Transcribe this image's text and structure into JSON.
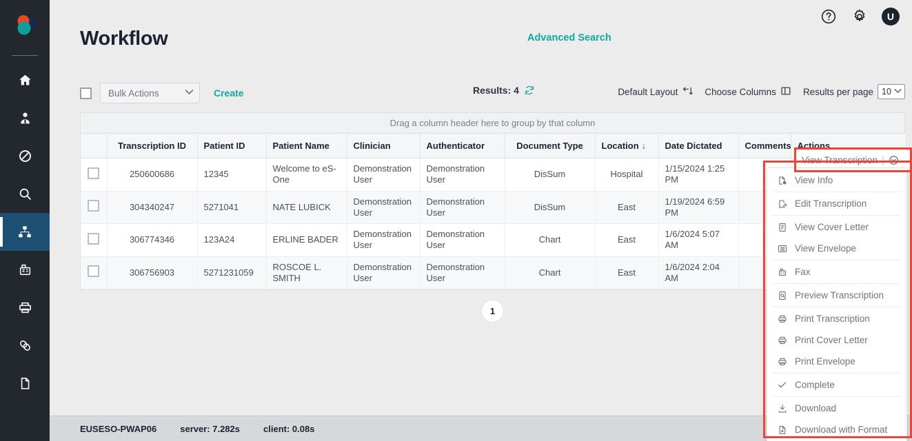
{
  "colors": {
    "sidebar_bg": "#23272e",
    "sidebar_active": "#1d4f73",
    "teal": "#10a8a0",
    "highlight_red": "#f04438",
    "text_dark": "#1b2330"
  },
  "sidebar": {
    "logo_name": "es-one-logo",
    "items": [
      {
        "name": "home-icon",
        "label": "Home",
        "active": false
      },
      {
        "name": "clinician-icon",
        "label": "Clinician",
        "active": false
      },
      {
        "name": "no-entry-icon",
        "label": "Restricted",
        "active": false
      },
      {
        "name": "search-icon",
        "label": "Search",
        "active": false
      },
      {
        "name": "workflow-icon",
        "label": "Workflow",
        "active": true
      },
      {
        "name": "fax-icon",
        "label": "Fax",
        "active": false
      },
      {
        "name": "print-icon",
        "label": "Print",
        "active": false
      },
      {
        "name": "link-icon",
        "label": "Links",
        "active": false
      },
      {
        "name": "document-icon",
        "label": "Documents",
        "active": false
      }
    ]
  },
  "header": {
    "title": "Workflow",
    "advanced_search": "Advanced Search",
    "help_icon": "help-circle-icon",
    "settings_icon": "gear-icon",
    "avatar_initial": "U"
  },
  "toolbar": {
    "select_all_checkbox": "",
    "bulk_actions_label": "Bulk Actions",
    "bulk_actions_caret": "chevron-down-icon",
    "create_label": "Create",
    "results_label": "Results: 4",
    "refresh_icon": "refresh-icon",
    "default_layout_label": "Default Layout",
    "default_layout_icon": "layout-reset-icon",
    "choose_columns_label": "Choose Columns",
    "choose_columns_icon": "columns-icon",
    "results_per_page_label": "Results per page",
    "results_per_page_value": "10"
  },
  "grid": {
    "group_hint": "Drag a column header here to group by that column",
    "columns": [
      "",
      "Transcription ID",
      "Patient ID",
      "Patient Name",
      "Clinician",
      "Authenticator",
      "Document Type",
      "Location",
      "Date Dictated",
      "Comments",
      "Actions"
    ],
    "sorted_column": "Location",
    "sort_direction_glyph": "↓",
    "rows": [
      {
        "transcription_id": "250600686",
        "patient_id": "12345",
        "patient_name": "Welcome to eS-One",
        "clinician": "Demonstration User",
        "authenticator": "Demonstration User",
        "document_type": "DisSum",
        "location": "Hospital",
        "date_dictated": "1/15/2024 1:25 PM",
        "comments": "",
        "actions": "View Transcription"
      },
      {
        "transcription_id": "304340247",
        "patient_id": "5271041",
        "patient_name": "NATE LUBICK",
        "clinician": "Demonstration User",
        "authenticator": "Demonstration User",
        "document_type": "DisSum",
        "location": "East",
        "date_dictated": "1/19/2024 6:59 PM",
        "comments": "",
        "actions": ""
      },
      {
        "transcription_id": "306774346",
        "patient_id": "123A24",
        "patient_name": "ERLINE BADER",
        "clinician": "Demonstration User",
        "authenticator": "Demonstration User",
        "document_type": "Chart",
        "location": "East",
        "date_dictated": "1/6/2024 5:07 AM",
        "comments": "",
        "actions": ""
      },
      {
        "transcription_id": "306756903",
        "patient_id": "5271231059",
        "patient_name": "ROSCOE L. SMITH",
        "clinician": "Demonstration User",
        "authenticator": "Demonstration User",
        "document_type": "Chart",
        "location": "East",
        "date_dictated": "1/6/2024 2:04 AM",
        "comments": "",
        "actions": ""
      }
    ]
  },
  "actions_menu": {
    "trigger_label": "View Transcription",
    "trigger_separator": "|",
    "trigger_caret_icon": "chevron-down-circle-icon",
    "items": [
      {
        "label": "View Info",
        "icon": "file-info-icon",
        "sep_after": true
      },
      {
        "label": "Edit Transcription",
        "icon": "file-edit-icon",
        "sep_after": true
      },
      {
        "label": "View Cover Letter",
        "icon": "file-text-icon",
        "sep_after": false
      },
      {
        "label": "View Envelope",
        "icon": "envelope-list-icon",
        "sep_after": true
      },
      {
        "label": "Fax",
        "icon": "fax-icon",
        "sep_after": true
      },
      {
        "label": "Preview Transcription",
        "icon": "file-search-icon",
        "sep_after": true
      },
      {
        "label": "Print Transcription",
        "icon": "printer-icon",
        "sep_after": false
      },
      {
        "label": "Print Cover Letter",
        "icon": "printer-icon",
        "sep_after": false
      },
      {
        "label": "Print Envelope",
        "icon": "printer-icon",
        "sep_after": true
      },
      {
        "label": "Complete",
        "icon": "check-icon",
        "sep_after": true
      },
      {
        "label": "Download",
        "icon": "download-icon",
        "sep_after": false
      },
      {
        "label": "Download with Format",
        "icon": "file-download-icon",
        "sep_after": false
      }
    ]
  },
  "pagination": {
    "current_page": "1"
  },
  "footer": {
    "server_name": "EUSESO-PWAP06",
    "server_time": "server: 7.282s",
    "client_time": "client: 0.08s"
  }
}
